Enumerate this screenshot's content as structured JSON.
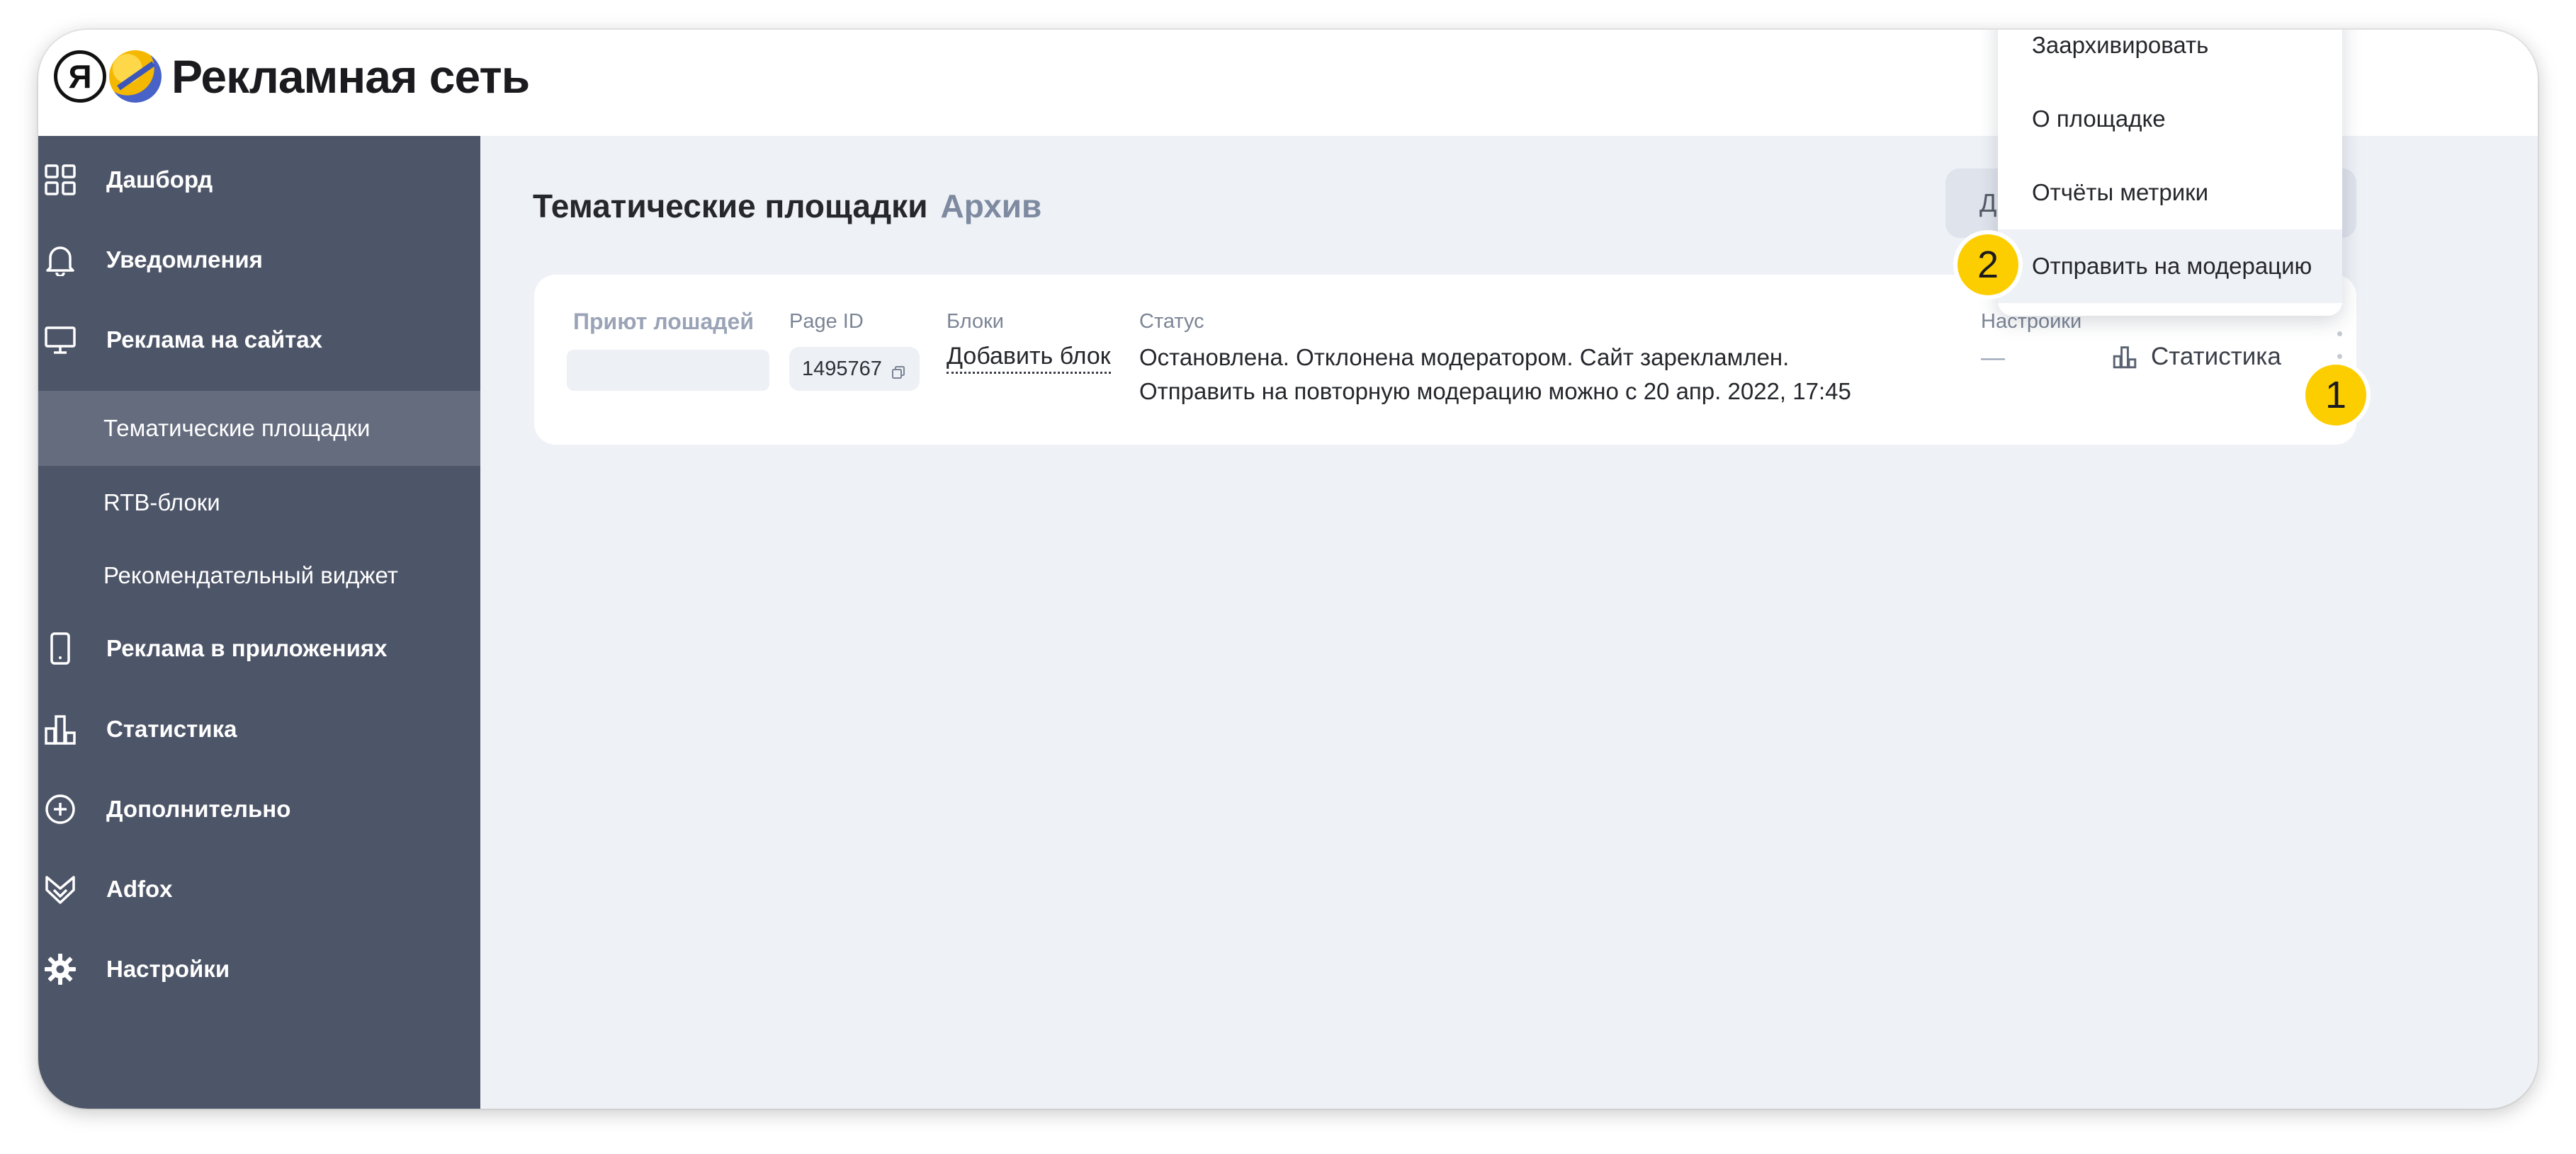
{
  "header": {
    "logo_letter": "Я",
    "logo_text": "Рекламная сеть"
  },
  "sidebar": {
    "items": [
      {
        "label": "Дашборд",
        "icon": "dashboard-grid-icon"
      },
      {
        "label": "Уведомления",
        "icon": "bell-icon"
      },
      {
        "label": "Реклама на сайтах",
        "icon": "monitor-icon"
      },
      {
        "label": "Тематические площадки",
        "sub": true,
        "active": true
      },
      {
        "label": "RTB-блоки",
        "sub": true
      },
      {
        "label": "Рекомендательный виджет",
        "sub": true
      },
      {
        "label": "Реклама в приложениях",
        "icon": "phone-icon"
      },
      {
        "label": "Статистика",
        "icon": "bar-chart-icon"
      },
      {
        "label": "Дополнительно",
        "icon": "plus-circle-icon"
      },
      {
        "label": "Adfox",
        "icon": "adfox-icon"
      },
      {
        "label": "Настройки",
        "icon": "gear-icon"
      }
    ]
  },
  "main": {
    "title": "Тематические площадки",
    "title_secondary": "Архив",
    "top_button_label": "Д",
    "table": {
      "site_name": "Приют лошадей",
      "columns": {
        "page_id": "Page ID",
        "blocks": "Блоки",
        "status": "Статус",
        "settings": "Настройки"
      },
      "row": {
        "page_id": "1495767",
        "add_block": "Добавить блок",
        "status_line1": "Остановлена. Отклонена модератором. Сайт зарекламлен.",
        "status_line2": "Отправить на повторную модерацию можно с 20 апр. 2022, 17:45",
        "settings_value": "—",
        "stats_link": "Статистика"
      }
    }
  },
  "dropdown": {
    "items": [
      "Заархивировать",
      "О площадке",
      "Отчёты метрики",
      "Отправить на модерацию"
    ],
    "hovered_index": 3
  },
  "callouts": {
    "badge1": "1",
    "badge2": "2",
    "color": "#fcce00"
  }
}
